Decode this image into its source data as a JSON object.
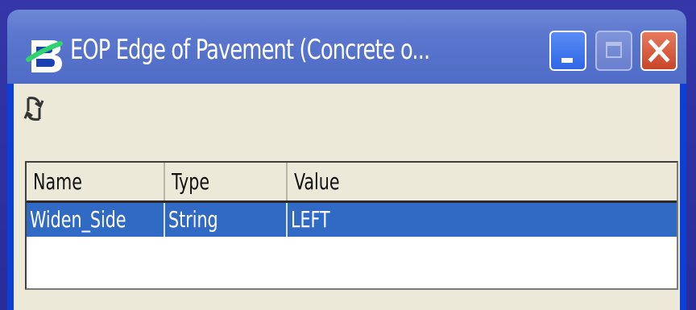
{
  "window": {
    "title": "EOP Edge of Pavement (Concrete o...",
    "icon": "bentley-b-icon",
    "controls": {
      "minimize": "minimize-icon",
      "maximize": "maximize-icon",
      "close": "close-icon"
    }
  },
  "toolbar": {
    "refresh_icon": "refresh-icon"
  },
  "grid": {
    "columns": [
      "Name",
      "Type",
      "Value"
    ],
    "rows": [
      {
        "name": "Widen_Side",
        "type": "String",
        "value": "LEFT",
        "selected": true
      }
    ]
  },
  "colors": {
    "titlebar": "#5a76ce",
    "selection": "#316ac5",
    "close_button": "#c8452a",
    "client_bg": "#ece9d8"
  }
}
